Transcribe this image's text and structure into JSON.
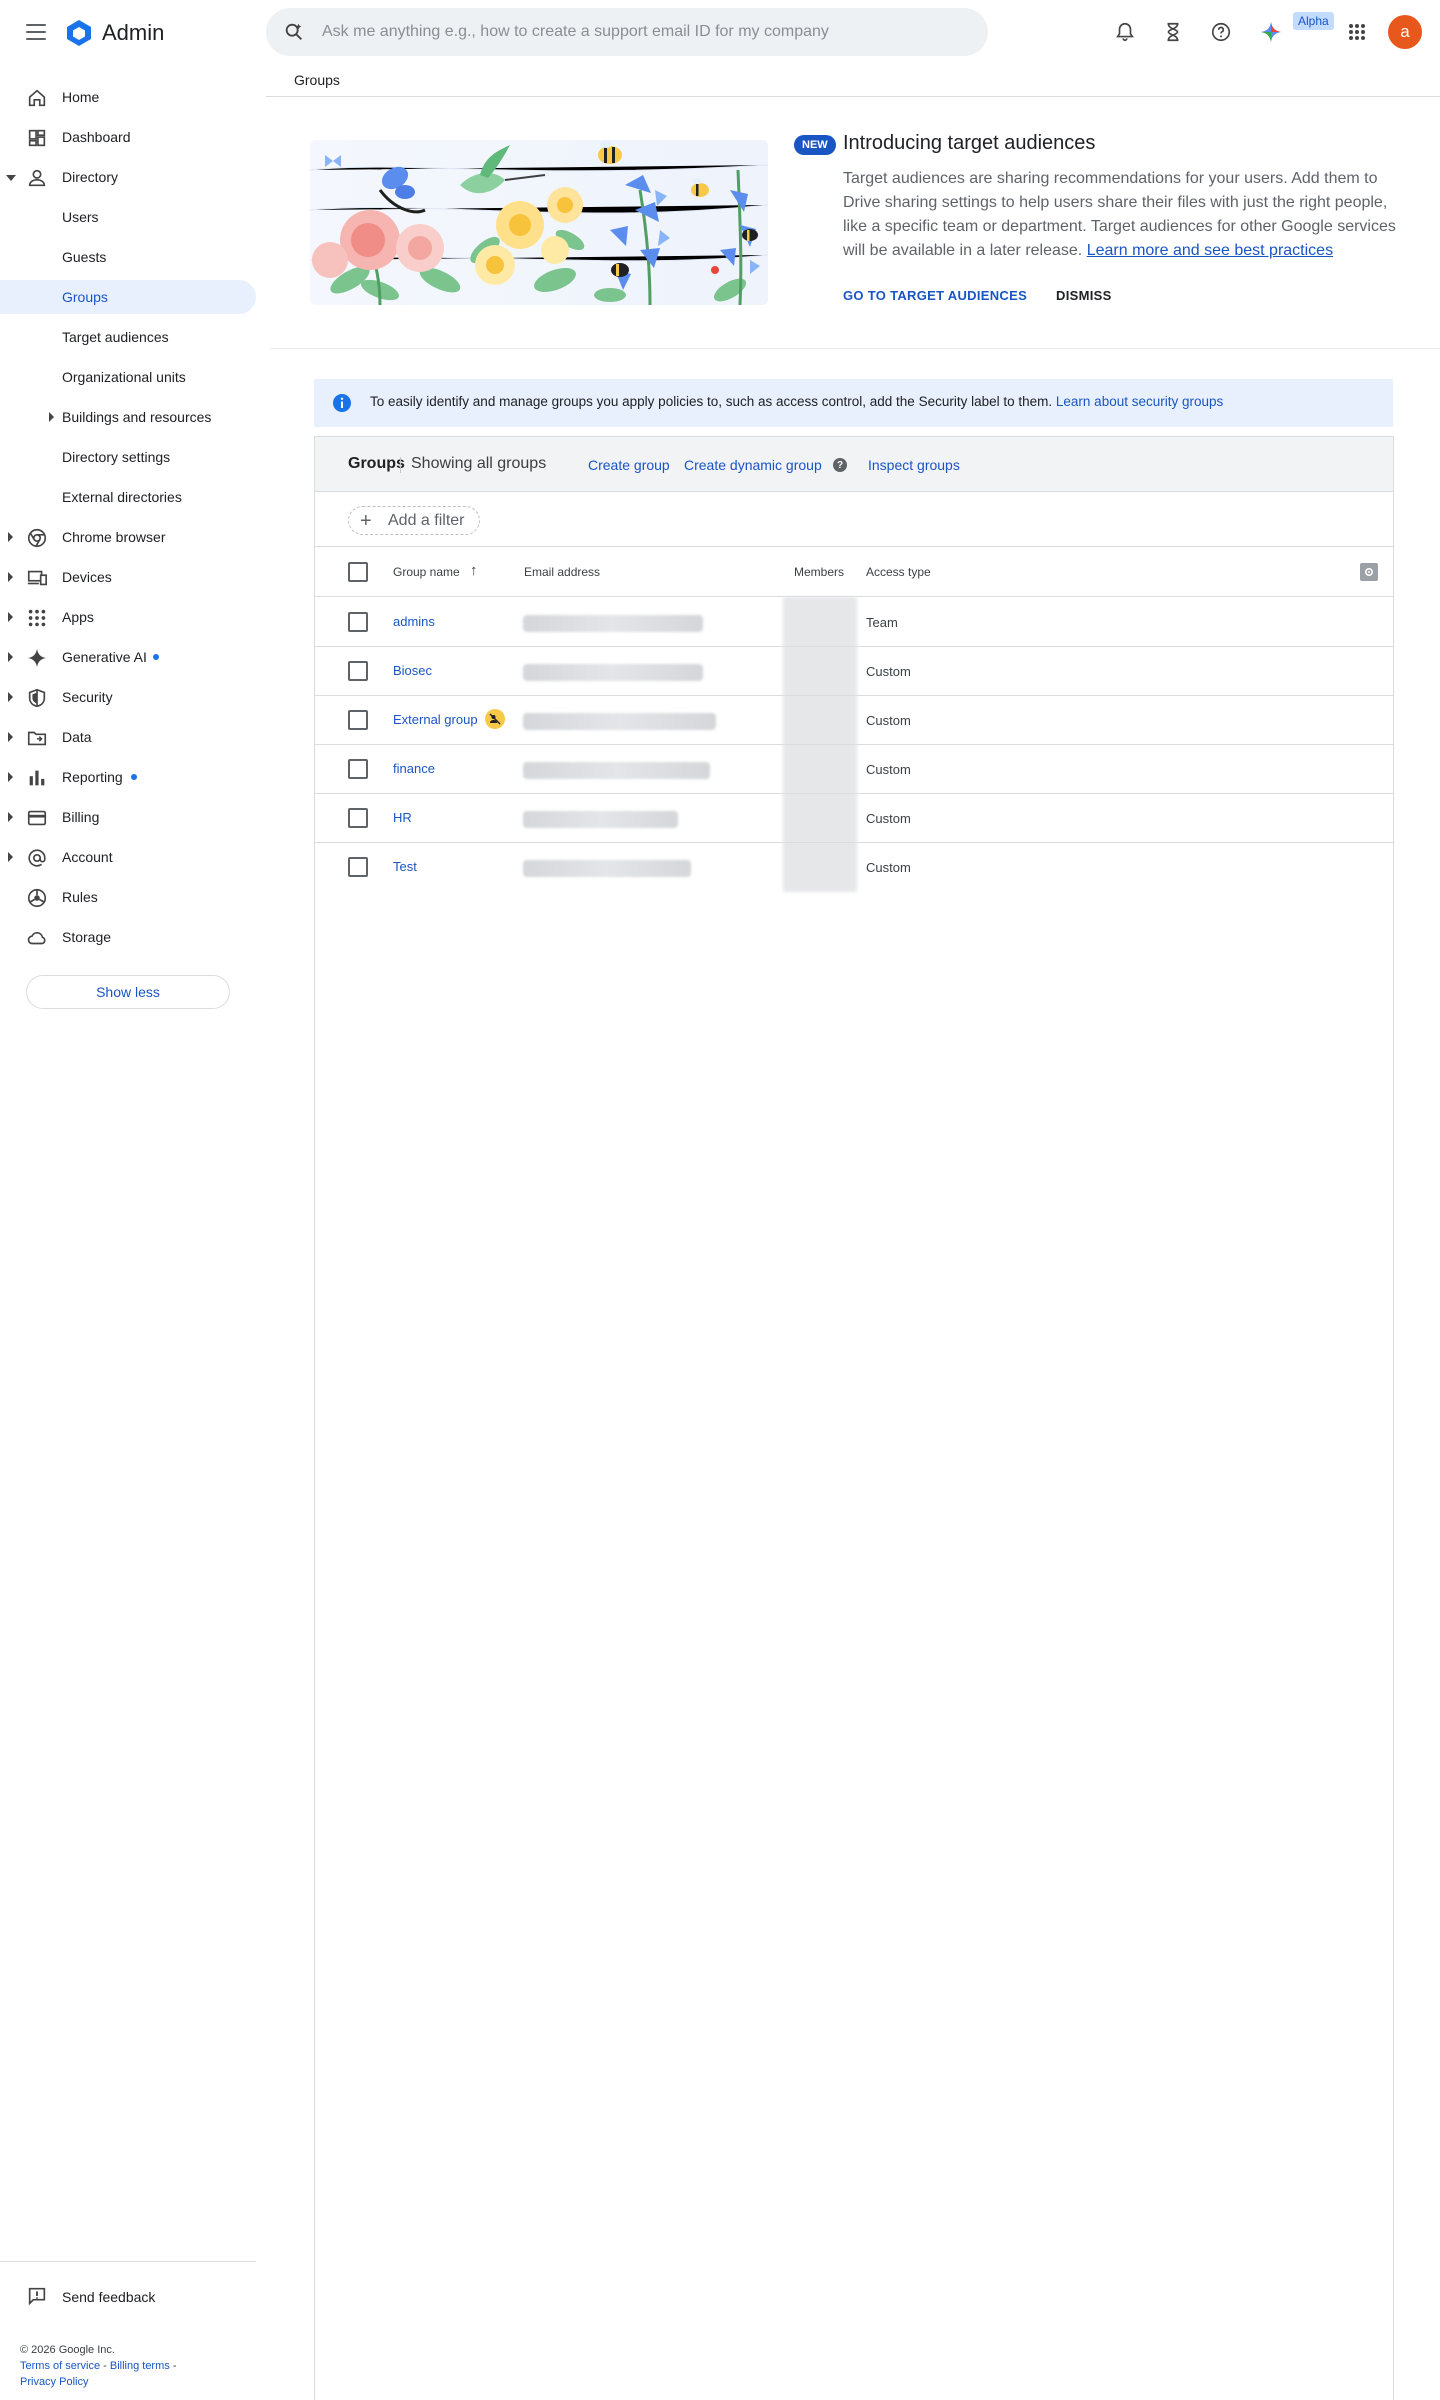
{
  "app": {
    "name": "Admin"
  },
  "search": {
    "placeholder": "Ask me anything e.g., how to create a support email ID for my company"
  },
  "topbar": {
    "alpha_badge": "Alpha",
    "avatar_letter": "a"
  },
  "sidebar": {
    "items": [
      {
        "label": "Home",
        "icon": "home-icon"
      },
      {
        "label": "Dashboard",
        "icon": "dashboard-icon"
      },
      {
        "label": "Directory",
        "icon": "person-icon"
      },
      {
        "label": "Users"
      },
      {
        "label": "Guests"
      },
      {
        "label": "Groups"
      },
      {
        "label": "Target audiences"
      },
      {
        "label": "Organizational units"
      },
      {
        "label": "Buildings and resources"
      },
      {
        "label": "Directory settings"
      },
      {
        "label": "External directories"
      },
      {
        "label": "Chrome browser",
        "icon": "chrome-icon"
      },
      {
        "label": "Devices",
        "icon": "devices-icon"
      },
      {
        "label": "Apps",
        "icon": "apps-grid-icon"
      },
      {
        "label": "Generative AI",
        "icon": "sparkle-icon"
      },
      {
        "label": "Security",
        "icon": "shield-icon"
      },
      {
        "label": "Data",
        "icon": "folder-icon"
      },
      {
        "label": "Reporting",
        "icon": "bar-chart-icon"
      },
      {
        "label": "Billing",
        "icon": "credit-card-icon"
      },
      {
        "label": "Account",
        "icon": "at-sign-icon"
      },
      {
        "label": "Rules",
        "icon": "rules-icon"
      },
      {
        "label": "Storage",
        "icon": "cloud-icon"
      }
    ],
    "show_less": "Show less",
    "send_feedback": "Send feedback"
  },
  "footer": {
    "copyright": "© 2026 Google Inc.",
    "terms": "Terms of service",
    "billing_terms": "Billing terms",
    "privacy": "Privacy Policy",
    "separator": " - "
  },
  "page": {
    "title": "Groups"
  },
  "promo": {
    "badge": "NEW",
    "title": "Introducing target audiences",
    "body": "Target audiences are sharing recommendations for your users. Add them to Drive sharing settings to help users share their files with just the right people, like a specific team or department. Target audiences for other Google services will be available in a later release.",
    "link": "Learn more and see best practices",
    "primary_action": "GO TO TARGET AUDIENCES",
    "dismiss": "DISMISS"
  },
  "info_banner": {
    "text": "To easily identify and manage groups you apply policies to, such as access control, add the Security label to them.",
    "link": "Learn about security groups"
  },
  "groups_card": {
    "title": "Groups",
    "subtitle": "Showing all groups",
    "create_group": "Create group",
    "create_dynamic_group": "Create dynamic group",
    "help": "?",
    "inspect_groups": "Inspect groups",
    "add_filter": "Add a filter",
    "columns": {
      "group_name": "Group name",
      "email": "Email address",
      "members": "Members",
      "access_type": "Access type"
    },
    "rows": [
      {
        "name": "admins",
        "access": "Team"
      },
      {
        "name": "Biosec",
        "access": "Custom"
      },
      {
        "name": "External group",
        "access": "Custom",
        "external": true
      },
      {
        "name": "finance",
        "access": "Custom"
      },
      {
        "name": "HR",
        "access": "Custom"
      },
      {
        "name": "Test",
        "access": "Custom"
      }
    ]
  },
  "colors": {
    "accent": "#1a55c4",
    "active_nav_bg": "#e8f0fe",
    "avatar": "#e8571c",
    "search_bg": "#eef1f4"
  }
}
